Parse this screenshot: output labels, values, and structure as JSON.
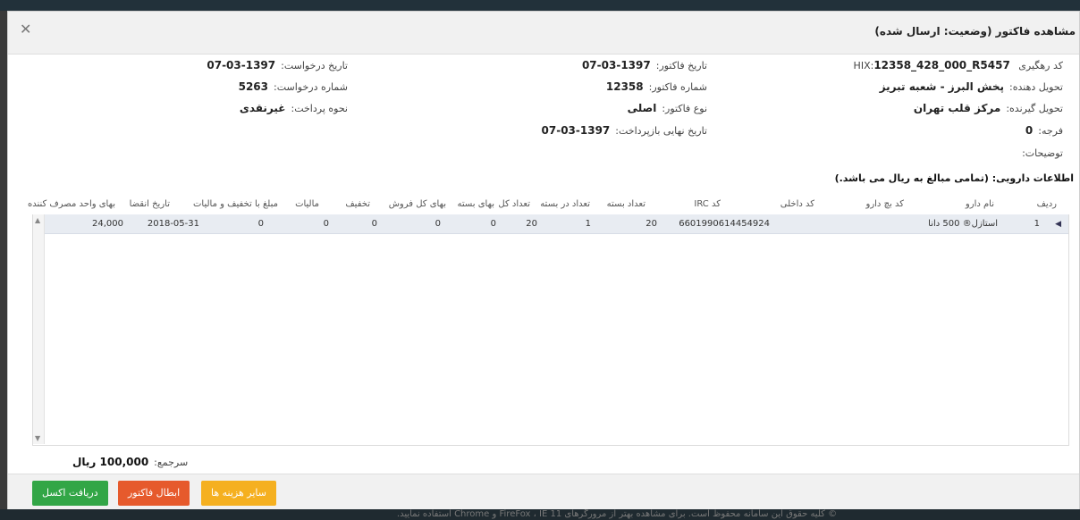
{
  "modal": {
    "title": "مشاهده فاکتور (وضعیت: ارسال شده)",
    "close_icon": "close-icon"
  },
  "invoice": {
    "hix_label": "کد رهگیری HIX:",
    "hix_value": "12358_428_000_R5457",
    "deliverer_label": "تحویل دهنده:",
    "deliverer_value": "پخش البرز - شعبه تبریز",
    "receiver_label": "تحویل گیرنده:",
    "receiver_value": "مرکز قلب تهران",
    "grace_label": "فرجه:",
    "grace_value": "0",
    "notes_label": "توضیحات:",
    "inv_date_label": "تاریخ فاکتور:",
    "inv_date_value": "1397-03-07",
    "inv_no_label": "شماره فاکتور:",
    "inv_no_value": "12358",
    "inv_type_label": "نوع فاکتور:",
    "inv_type_value": "اصلی",
    "due_label": "تاریخ نهایی بازپرداخت:",
    "due_value": "1397-03-07",
    "req_date_label": "تاریخ درخواست:",
    "req_date_value": "1397-03-07",
    "req_no_label": "شماره درخواست:",
    "req_no_value": "5263",
    "pay_label": "نحوه پرداخت:",
    "pay_value": "غیرنقدی"
  },
  "notice": "اطلاعات دارویی: (تمامی مبالغ به ریال می باشد.)",
  "table": {
    "headers": {
      "row": "ردیف",
      "name": "نام دارو",
      "batch": "کد بچ دارو",
      "internal": "کد داخلی",
      "irc": "کد IRC",
      "pack_count": "تعداد بسته",
      "per_pack": "تعداد در بسته",
      "total_count": "تعداد کل",
      "pack_price": "بهای بسته",
      "total_sale": "بهای کل فروش",
      "discount": "تخفیف",
      "tax": "مالیات",
      "amount": "مبلغ با تخفیف و مالیات",
      "expiry": "تاریخ انقضا",
      "consumer_price": "بهای واحد مصرف کننده"
    },
    "rows": [
      {
        "row": "1",
        "name": "استازل® 500 دانا",
        "batch": "",
        "internal": "",
        "irc": "6601990614454924",
        "pack_count": "20",
        "per_pack": "1",
        "total_count": "20",
        "pack_price": "0",
        "total_sale": "0",
        "discount": "0",
        "tax": "0",
        "amount": "0",
        "expiry": "2018-05-31",
        "consumer_price": "24,000"
      }
    ]
  },
  "total": {
    "label": "سرجمع:",
    "value": "100,000 ریال"
  },
  "buttons": {
    "excel": "دریافت اکسل",
    "cancel": "ابطال فاکتور",
    "other": "سایر هزینه ها"
  },
  "footer_text": "© کلیه حقوق این سامانه محفوظ است. برای مشاهده بهتر از مرورگرهای FireFox ، IE 11 و Chrome استفاده نمایید."
}
